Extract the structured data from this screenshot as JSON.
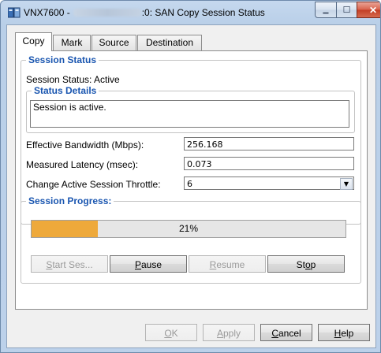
{
  "window": {
    "title_prefix": "VNX7600 -",
    "title_suffix": ":0: SAN Copy Session Status",
    "minimize_glyph": "▁",
    "maximize_glyph": "☐",
    "close_glyph": "✕"
  },
  "tabs": [
    {
      "label": "Copy",
      "active": true
    },
    {
      "label": "Mark"
    },
    {
      "label": "Source"
    },
    {
      "label": "Destination"
    }
  ],
  "session_status": {
    "legend": "Session Status",
    "status_text": "Session Status: Active",
    "details_legend": "Status Details",
    "details_value": "Session is active."
  },
  "fields": {
    "bandwidth_label": "Effective Bandwidth (Mbps):",
    "bandwidth_value": "256.168",
    "latency_label": "Measured Latency (msec):",
    "latency_value": "0.073",
    "throttle_label": "Change Active Session Throttle:",
    "throttle_value": "6",
    "throttle_arrow": "▼"
  },
  "progress": {
    "legend": "Session Progress:",
    "percent": 21,
    "percent_text": "21%",
    "fill_color": "#eea93b"
  },
  "session_buttons": {
    "start": {
      "pre": "",
      "key": "S",
      "post": "tart Ses..."
    },
    "pause": {
      "pre": "",
      "key": "P",
      "post": "ause"
    },
    "resume": {
      "pre": "",
      "key": "R",
      "post": "esume"
    },
    "stop": {
      "pre": "St",
      "key": "o",
      "post": "p"
    }
  },
  "dialog_buttons": {
    "ok": {
      "pre": "",
      "key": "O",
      "post": "K"
    },
    "apply": {
      "pre": "",
      "key": "A",
      "post": "pply"
    },
    "cancel": {
      "pre": "",
      "key": "C",
      "post": "ancel"
    },
    "help": {
      "pre": "",
      "key": "H",
      "post": "elp"
    }
  },
  "colors": {
    "legend_text": "#1a56b0",
    "title_bar": "#c5d8ee",
    "close_button": "#c23d23"
  }
}
